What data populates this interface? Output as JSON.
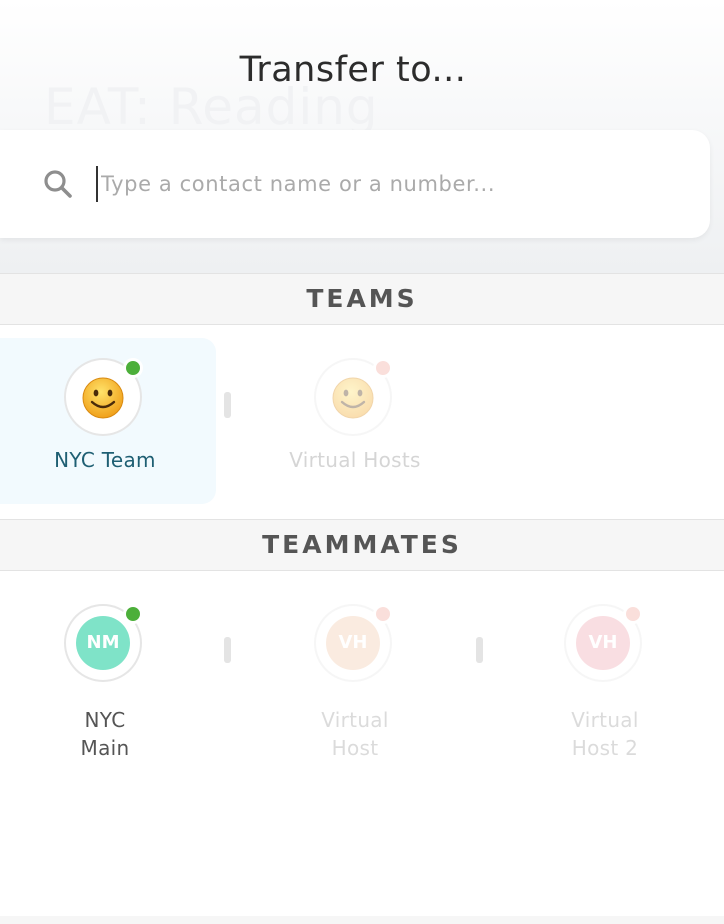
{
  "dialog": {
    "title": "Transfer to...",
    "background_title": "EAT: Reading"
  },
  "search": {
    "placeholder": "Type a contact name or a number...",
    "value": "",
    "icon": "search-icon"
  },
  "sections": {
    "teams": {
      "header": "TEAMS",
      "items": [
        {
          "label": "NYC Team",
          "icon": "smiley-icon",
          "status": "online",
          "status_color": "#4caf3a",
          "selected": true
        },
        {
          "label": "Virtual Hosts",
          "icon": "smiley-icon",
          "status": "offline",
          "status_color": "#f2a49a",
          "selected": false
        }
      ]
    },
    "teammates": {
      "header": "TEAMMATES",
      "items": [
        {
          "initials": "NM",
          "label_line1": "NYC",
          "label_line2": "Main",
          "color": "#7fe3c8",
          "status": "online"
        },
        {
          "initials": "VH",
          "label_line1": "Virtual",
          "label_line2": "Host",
          "color": "#f2c8a8",
          "status": "offline"
        },
        {
          "initials": "VH",
          "label_line1": "Virtual",
          "label_line2": "Host 2",
          "color": "#f0a3ad",
          "status": "offline"
        }
      ]
    }
  },
  "colors": {
    "accent": "#1f5f73",
    "selected_bg": "#f2fafe",
    "online": "#4caf3a",
    "offline": "#f2a49a"
  }
}
